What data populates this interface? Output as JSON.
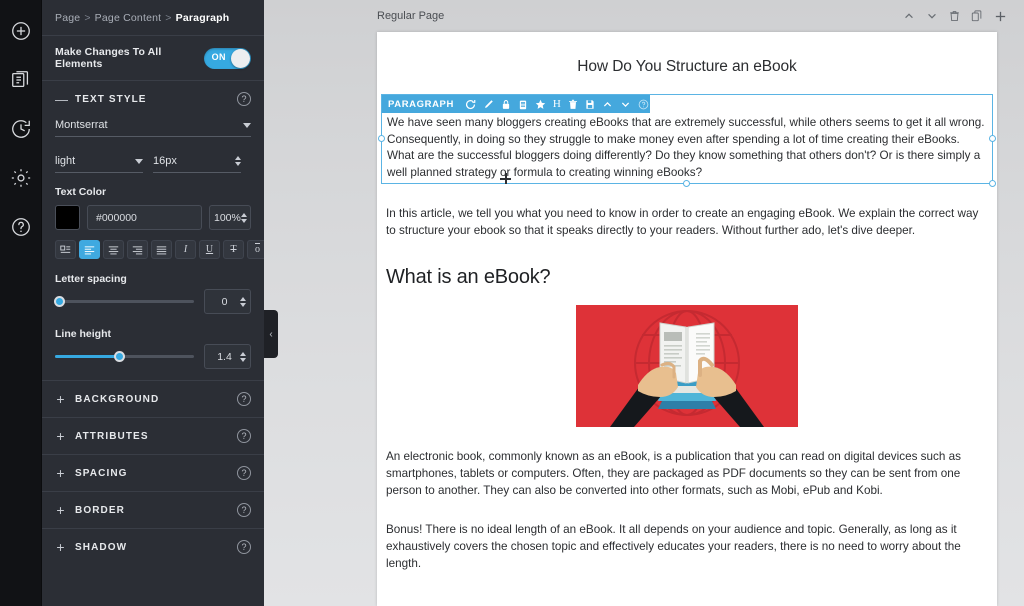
{
  "rail": {
    "items": [
      {
        "name": "add-icon",
        "label": "Add"
      },
      {
        "name": "pages-icon",
        "label": "Pages"
      },
      {
        "name": "history-icon",
        "label": "History"
      },
      {
        "name": "settings-icon",
        "label": "Settings"
      },
      {
        "name": "help-icon",
        "label": "Help"
      }
    ]
  },
  "sidebar": {
    "breadcrumb": {
      "root": "Page",
      "middle": "Page Content",
      "current": "Paragraph",
      "separator": ">"
    },
    "make_changes": {
      "label": "Make Changes To All Elements",
      "toggle_state": "ON"
    },
    "text_style": {
      "section_title": "TEXT STYLE",
      "collapse_sign": "—",
      "font_family": "Montserrat",
      "font_weight": "light",
      "font_size": "16px",
      "text_color_label": "Text Color",
      "text_color_hex": "#000000",
      "text_color_opacity": "100%",
      "align_buttons": [
        {
          "name": "indent-icon",
          "glyph": "≡",
          "active": false
        },
        {
          "name": "align-left-icon",
          "glyph": "≡",
          "active": true
        },
        {
          "name": "align-center-icon",
          "glyph": "≡",
          "active": false
        },
        {
          "name": "align-right-icon",
          "glyph": "≡",
          "active": false
        },
        {
          "name": "align-justify-icon",
          "glyph": "≡",
          "active": false
        },
        {
          "name": "italic-icon",
          "glyph": "I",
          "active": false
        },
        {
          "name": "underline-icon",
          "glyph": "U",
          "active": false
        },
        {
          "name": "strikethrough-icon",
          "glyph": "T",
          "active": false
        },
        {
          "name": "overline-icon",
          "glyph": "o",
          "active": false
        }
      ],
      "letter_spacing": {
        "label": "Letter spacing",
        "value": "0",
        "percent": 0
      },
      "line_height": {
        "label": "Line height",
        "value": "1.4",
        "percent": 46
      }
    },
    "accordion": [
      {
        "label": "BACKGROUND",
        "sign": "+"
      },
      {
        "label": "ATTRIBUTES",
        "sign": "+"
      },
      {
        "label": "SPACING",
        "sign": "+"
      },
      {
        "label": "BORDER",
        "sign": "+"
      },
      {
        "label": "SHADOW",
        "sign": "+"
      }
    ],
    "collapse_handle": "‹"
  },
  "canvas": {
    "page_bar": {
      "page_label": "Regular Page",
      "tools": [
        {
          "name": "move-up-icon",
          "glyph": "∧"
        },
        {
          "name": "move-down-icon",
          "glyph": "∨"
        },
        {
          "name": "delete-page-icon",
          "glyph": "trash"
        },
        {
          "name": "duplicate-page-icon",
          "glyph": "copy"
        },
        {
          "name": "add-page-icon",
          "glyph": "+"
        }
      ]
    },
    "document": {
      "title": "How Do You Structure an eBook",
      "selected_element": {
        "tag": "PARAGRAPH",
        "toolbar_icons": [
          {
            "name": "refresh-icon"
          },
          {
            "name": "edit-pencil-icon"
          },
          {
            "name": "lock-icon"
          },
          {
            "name": "clipboard-icon"
          },
          {
            "name": "star-icon"
          },
          {
            "name": "heading-icon",
            "glyph": "H"
          },
          {
            "name": "trash-icon"
          },
          {
            "name": "save-icon"
          },
          {
            "name": "move-up-icon",
            "glyph": "∧"
          },
          {
            "name": "move-down-icon",
            "glyph": "∨"
          },
          {
            "name": "help-icon",
            "glyph": "?"
          }
        ],
        "text": "We have seen many bloggers creating eBooks that are extremely successful, while others seems to get it all wrong. Consequently, in doing so they struggle to make money even after spending a lot of time creating their eBooks. What are the successful bloggers doing differently? Do they know something that others don't? Or is there simply a well planned strategy or formula to creating winning eBooks?"
      },
      "paragraph_2": "In this article, we tell you what you need to know in order to create an engaging eBook. We explain the correct way to structure your ebook so that it speaks directly to your readers. Without further ado, let's dive deeper.",
      "heading_2": "What is an eBook?",
      "illustration": {
        "name": "ebook-reading-illustration",
        "background_color": "#de3238",
        "description": "Hands holding an open book over a stack of books on a red globe background"
      },
      "paragraph_3": "An electronic book, commonly known as an eBook, is a publication that you can read on digital devices such as smartphones, tablets or computers. Often, they are packaged as PDF documents so they can be sent from one person to another. They can also be converted into other formats, such as Mobi, ePub and Kobi.",
      "paragraph_4": "Bonus! There is no ideal length of an eBook. It all depends on your audience and topic. Generally, as long as it exhaustively covers the chosen topic and effectively educates your readers, there is no need to worry about the length."
    }
  },
  "colors": {
    "accent": "#36a9e1",
    "sidebar_bg": "#2b2e35",
    "rail_bg": "#111215",
    "illustration_red": "#de3238",
    "selection_blue": "#45a8dd"
  }
}
